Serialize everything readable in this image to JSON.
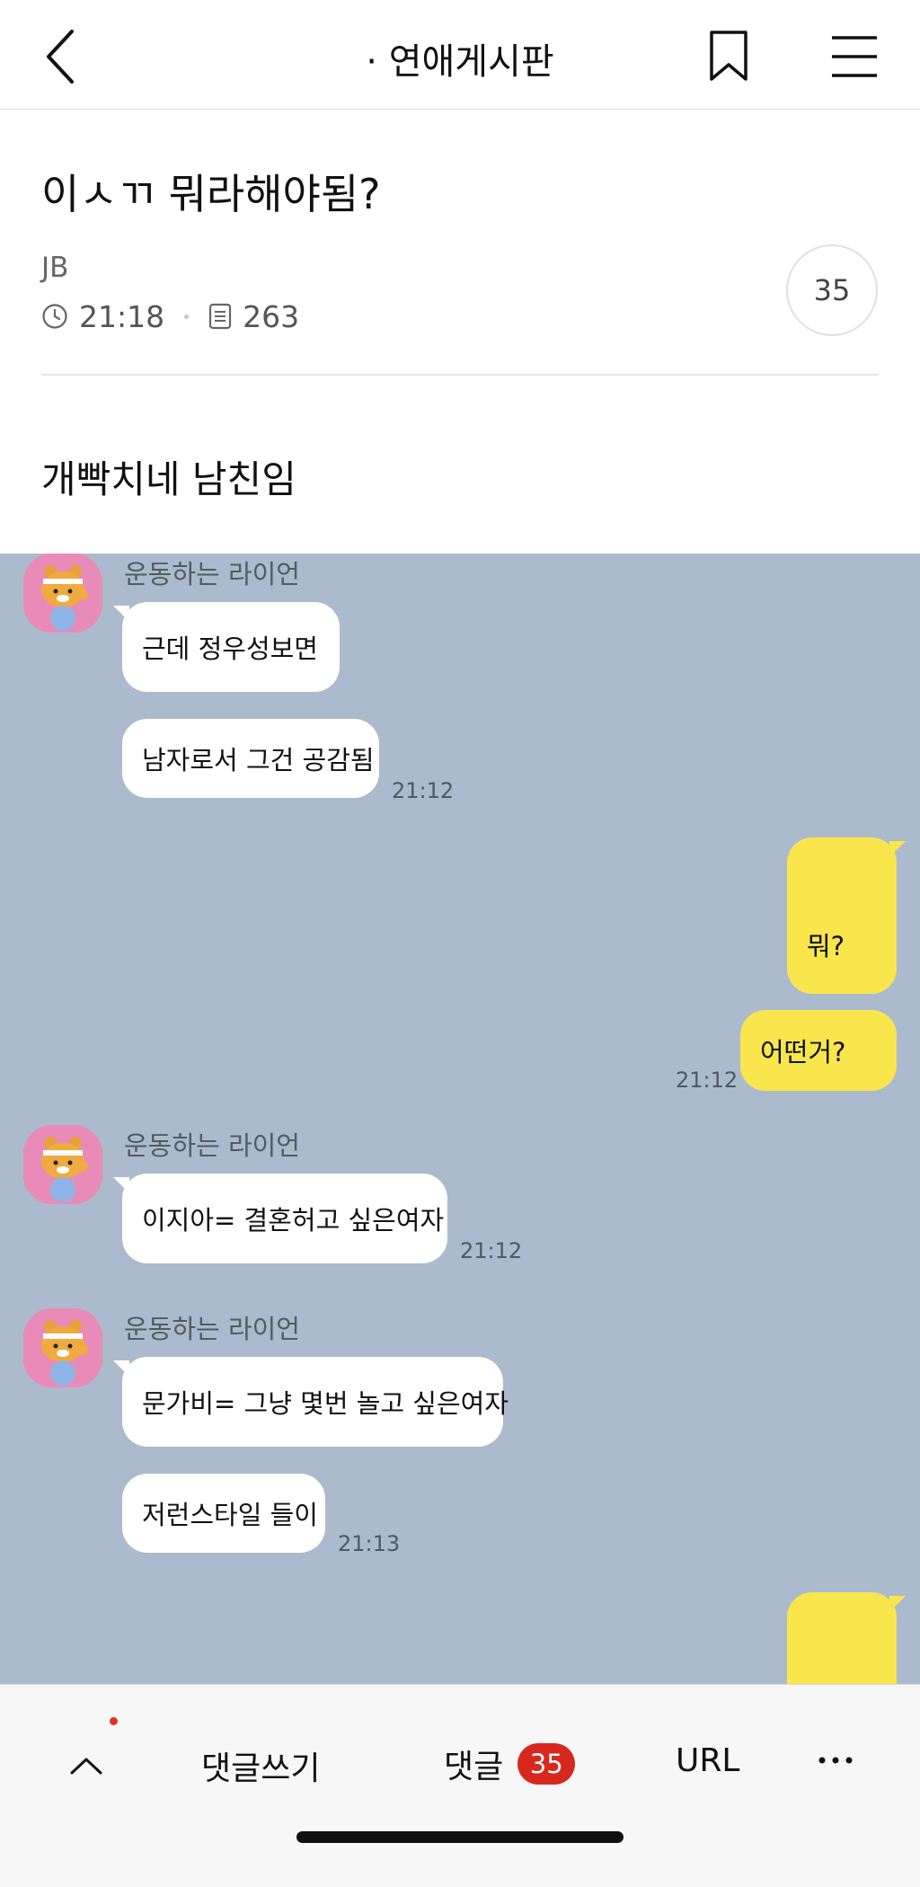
{
  "nav": {
    "board_title": "· 연애게시판",
    "back_icon": "chevron-left-icon",
    "bookmark_icon": "bookmark-icon",
    "menu_icon": "hamburger-menu-icon"
  },
  "post": {
    "title": "이ㅅㄲ 뭐라해야됨?",
    "author": "JB",
    "time": "21:18",
    "views": "263",
    "comment_count": "35",
    "body": "개빡치네 남친임"
  },
  "chat": {
    "background": "#abbbcd",
    "messages": [
      {
        "side": "left",
        "sender": "운동하는 라이언",
        "texts": [
          "근데 정우성보면",
          "남자로서 그건 공감됨"
        ],
        "time": "21:12"
      },
      {
        "side": "right",
        "texts": [
          "뭐?",
          "어떤거?"
        ],
        "time": "21:12"
      },
      {
        "side": "left",
        "sender": "운동하는 라이언",
        "texts": [
          "이지아= 결혼허고 싶은여자"
        ],
        "time": "21:12"
      },
      {
        "side": "left",
        "sender": "운동하는 라이언",
        "texts": [
          "문가비= 그냥 몇번 놀고 싶은여자",
          "저런스타일 들이"
        ],
        "time": "21:13"
      }
    ]
  },
  "bottom_bar": {
    "write_comment": "댓글쓰기",
    "comments": "댓글",
    "comments_count": "35",
    "url": "URL",
    "scroll_top_icon": "chevron-up-icon",
    "more_icon": "more-horizontal-icon",
    "badge_color": "#d8281d"
  },
  "colors": {
    "bubble_white": "#ffffff",
    "bubble_yellow": "#f9e64d",
    "avatar_pink": "#e98bb8"
  }
}
